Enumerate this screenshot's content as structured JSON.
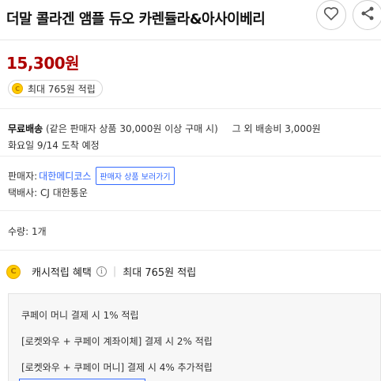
{
  "product": {
    "title": "더말 콜라겐 앰플 듀오 카렌듈라&아사이베리",
    "price": "15,300원"
  },
  "icons": {
    "wishlist": "heart-outline-icon",
    "share": "share-icon",
    "coin": "coin-icon",
    "info": "info-icon"
  },
  "reward": {
    "coin_symbol": "C",
    "text": "최대 765원 적립"
  },
  "shipping": {
    "label": "무료배송",
    "condition": "(같은 판매자 상품 30,000원 이상 구매 시)",
    "other": "그 외 배송비 3,000원",
    "arrival": "화요일 9/14 도착 예정"
  },
  "seller": {
    "label": "판매자:",
    "name": "대한메디코스",
    "button": "판매자 상품 보러가기",
    "courier": "택배사: CJ 대한통운"
  },
  "quantity": {
    "text": "수량: 1개"
  },
  "cash_reward": {
    "coin_symbol": "C",
    "label": "캐시적립 혜택",
    "info_symbol": "i",
    "divider": "|",
    "max": "최대 765원 적립"
  },
  "benefits": [
    "쿠페이 머니 결제 시 1% 적립",
    "[로켓와우 + 쿠페이 계좌이체] 결제 시 2% 적립",
    "[로켓와우 + 쿠페이 머니] 결제 시 4% 추가적립"
  ],
  "colors": {
    "price": "#ae0000",
    "link": "#346aff",
    "coin": "#ffcc00"
  }
}
